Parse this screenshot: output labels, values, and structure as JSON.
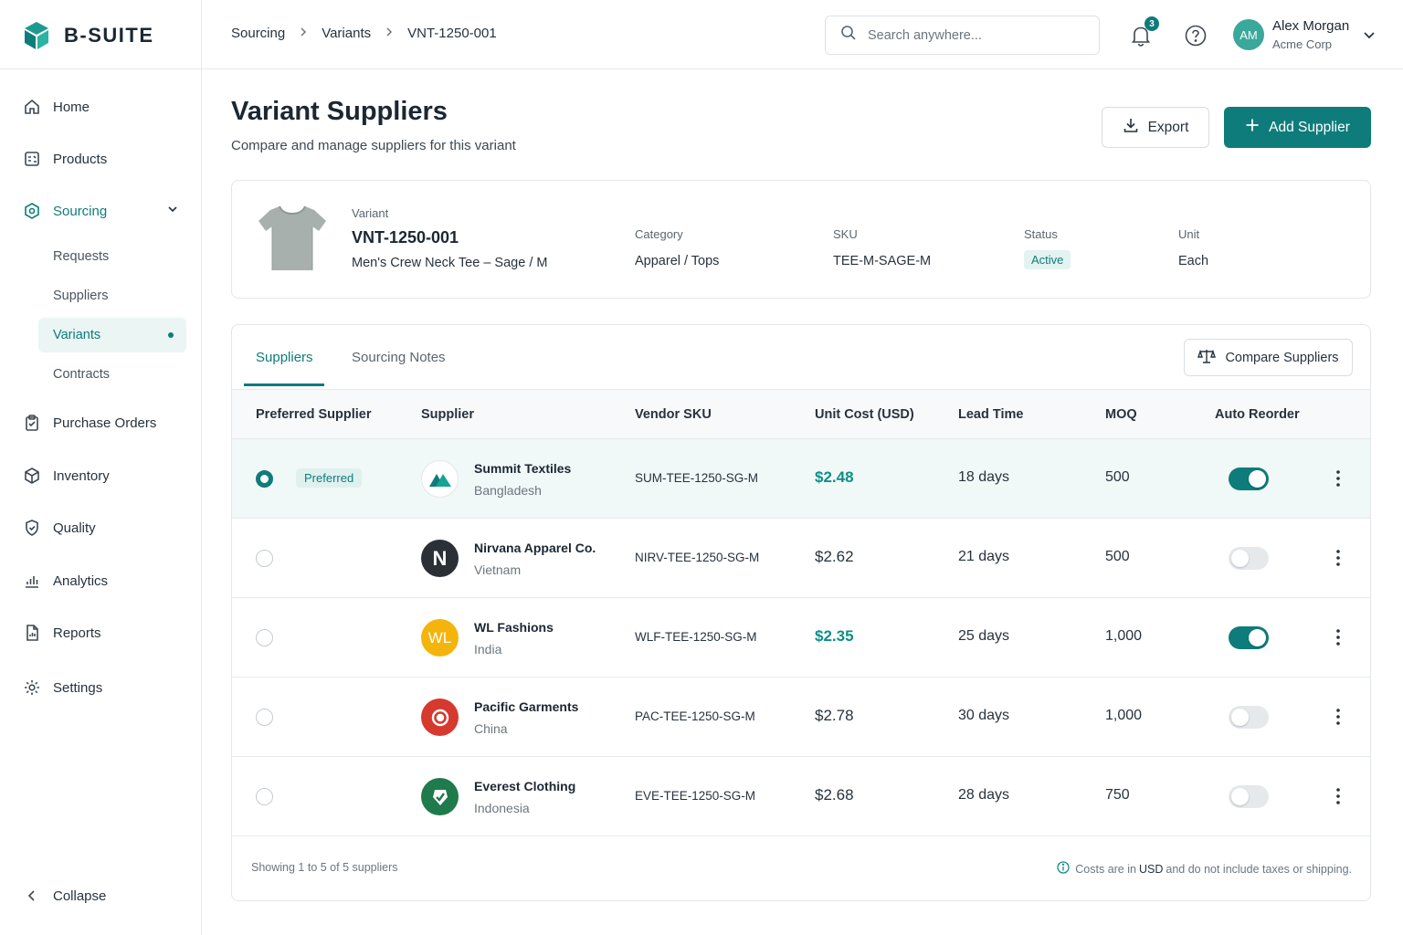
{
  "app": {
    "name": "B-SUITE"
  },
  "sidebar": {
    "items": [
      {
        "label": "Home",
        "icon": "home-icon"
      },
      {
        "label": "Products",
        "icon": "products-icon"
      },
      {
        "label": "Sourcing",
        "icon": "sourcing-icon",
        "active": true
      },
      {
        "label": "Purchase Orders",
        "icon": "purchase-orders-icon"
      },
      {
        "label": "Inventory",
        "icon": "inventory-icon"
      },
      {
        "label": "Quality",
        "icon": "shield-icon"
      },
      {
        "label": "Analytics",
        "icon": "analytics-icon"
      },
      {
        "label": "Reports",
        "icon": "reports-icon"
      },
      {
        "label": "Settings",
        "icon": "gear-icon"
      }
    ],
    "sourcing_sub": [
      "Requests",
      "Suppliers",
      "Variants",
      "Contracts"
    ],
    "collapse_label": "Collapse"
  },
  "breadcrumb": [
    "Sourcing",
    "Variants",
    "VNT-1250-001"
  ],
  "search": {
    "placeholder": "Search anywhere..."
  },
  "notifications": {
    "count": "3"
  },
  "user": {
    "initials": "AM",
    "name": "Alex Morgan",
    "org": "Acme Corp"
  },
  "page": {
    "title": "Variant Suppliers",
    "subtitle": "Compare and manage suppliers for this variant",
    "export_label": "Export",
    "add_label": "Add Supplier"
  },
  "variant": {
    "variant_label": "Variant",
    "code": "VNT-1250-001",
    "name": "Men's Crew Neck Tee – Sage / M",
    "category_label": "Category",
    "category": "Apparel / Tops",
    "sku_label": "SKU",
    "sku": "TEE-M-SAGE-M",
    "status_label": "Status",
    "status": "Active",
    "unit_label": "Unit",
    "unit": "Each"
  },
  "tabs": [
    "Suppliers",
    "Sourcing Notes"
  ],
  "compare_label": "Compare Suppliers",
  "table": {
    "headers": [
      "Preferred Supplier",
      "Supplier",
      "Vendor SKU",
      "Unit Cost (USD)",
      "Lead Time",
      "MOQ",
      "Auto Reorder"
    ],
    "preferred_label": "Preferred",
    "rows": [
      {
        "name": "Summit Textiles",
        "country": "Bangladesh",
        "sku": "SUM-TEE-1250-SG-M",
        "cost": "$2.48",
        "lead": "18 days",
        "moq": "500",
        "auto_reorder": true,
        "preferred": true,
        "logo": "summit-logo",
        "logo_color": "#ffffff"
      },
      {
        "name": "Nirvana Apparel Co.",
        "country": "Vietnam",
        "sku": "NIRV-TEE-1250-SG-M",
        "cost": "$2.62",
        "lead": "21 days",
        "moq": "500",
        "auto_reorder": false,
        "preferred": false,
        "logo": "N",
        "logo_color": "#2b3036"
      },
      {
        "name": "WL Fashions",
        "country": "India",
        "sku": "WLF-TEE-1250-SG-M",
        "cost": "$2.35",
        "lead": "25 days",
        "moq": "1,000",
        "auto_reorder": true,
        "preferred": false,
        "logo": "WL",
        "logo_color": "#f5b40b"
      },
      {
        "name": "Pacific Garments",
        "country": "China",
        "sku": "PAC-TEE-1250-SG-M",
        "cost": "$2.78",
        "lead": "30 days",
        "moq": "1,000",
        "auto_reorder": false,
        "preferred": false,
        "logo": "target-logo",
        "logo_color": "#d6392e"
      },
      {
        "name": "Everest Clothing",
        "country": "Indonesia",
        "sku": "EVE-TEE-1250-SG-M",
        "cost": "$2.68",
        "lead": "28 days",
        "moq": "750",
        "auto_reorder": false,
        "preferred": false,
        "logo": "check-logo",
        "logo_color": "#1f7a4c"
      }
    ]
  },
  "footer": {
    "showing": "Showing 1 to 5 of 5 suppliers",
    "note_pre": "Costs are in",
    "note_strong": "USD",
    "note_post": "and do not include taxes or shipping."
  },
  "colors": {
    "accent": "#0e7c7b",
    "best_price": "#0e8f86"
  }
}
